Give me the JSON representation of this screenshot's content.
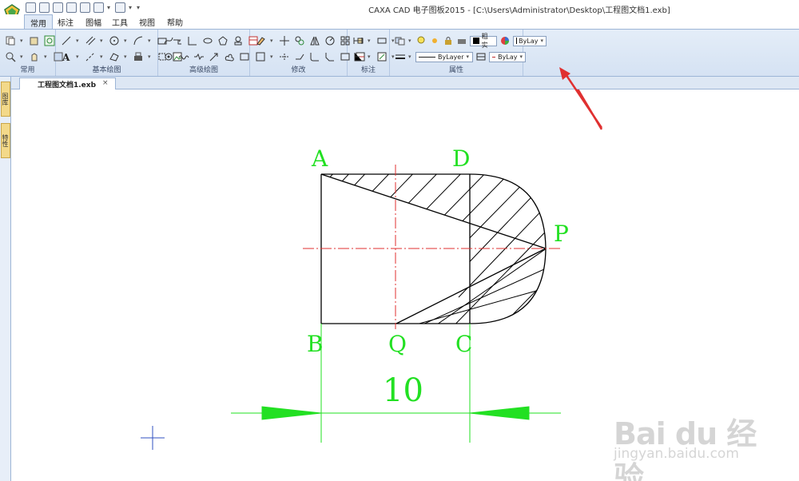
{
  "window": {
    "title": "CAXA CAD 电子图板2015 - [C:\\Users\\Administrator\\Desktop\\工程图文档1.exb]"
  },
  "menu": {
    "tabs": [
      {
        "label": "常用",
        "active": true
      },
      {
        "label": "标注",
        "active": false
      },
      {
        "label": "图幅",
        "active": false
      },
      {
        "label": "工具",
        "active": false
      },
      {
        "label": "视图",
        "active": false
      },
      {
        "label": "帮助",
        "active": false
      }
    ]
  },
  "ribbon": {
    "groups": {
      "common": "常用",
      "basic_draw": "基本绘图",
      "advanced_draw": "高级绘图",
      "modify": "修改",
      "dimension": "标注",
      "properties": "属性"
    },
    "properties": {
      "line_weight": "粗实",
      "color_value": "ByLay",
      "linetype_value": "ByLayer",
      "lineweight_value": "ByLay"
    }
  },
  "sidepanel": {
    "tabs": [
      "图库",
      "特性"
    ]
  },
  "document": {
    "tab_label": "工程图文档1.exb",
    "close_glyph": "×"
  },
  "drawing": {
    "labels": {
      "A": "A",
      "B": "B",
      "C": "C",
      "D": "D",
      "P": "P",
      "Q": "Q"
    },
    "dimension_value": "10"
  },
  "watermark": {
    "main": "Bai du 经验",
    "sub": "jingyan.baidu.com"
  },
  "colors": {
    "label_green": "#22e022",
    "centerline_red": "#e03030",
    "annotation_arrow": "#e03030",
    "ribbon_bg": "#d5e2f3"
  }
}
